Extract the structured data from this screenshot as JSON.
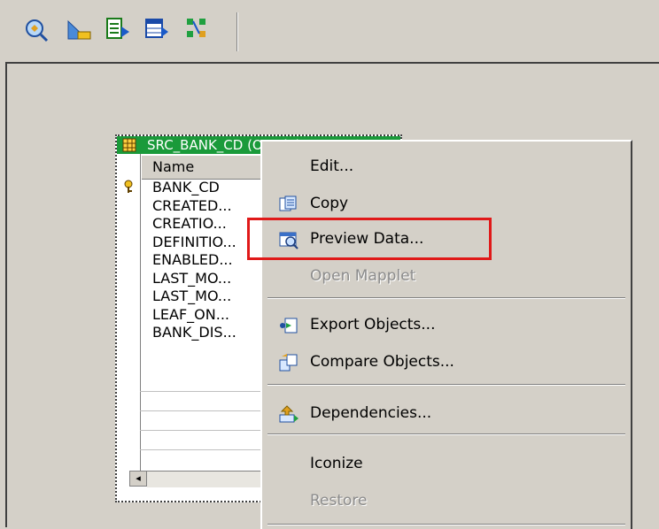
{
  "toolbar": {
    "buttons": [
      {
        "icon": "source-analyzer-icon"
      },
      {
        "icon": "target-designer-icon"
      },
      {
        "icon": "transformation-developer-icon"
      },
      {
        "icon": "mapplet-designer-icon"
      },
      {
        "icon": "mapping-designer-icon"
      }
    ]
  },
  "source_widget": {
    "title": "SRC_BANK_CD (Oracle)",
    "column_header": "Name",
    "rows": [
      "BANK_CD",
      "CREATED...",
      "CREATIO...",
      "DEFINITIO...",
      "ENABLED...",
      "LAST_MO...",
      "LAST_MO...",
      "LEAF_ON...",
      "BANK_DIS..."
    ],
    "scroll_left_arrow": "◂"
  },
  "context_menu": {
    "items": [
      {
        "label": "Edit...",
        "enabled": true
      },
      {
        "label": "Copy",
        "enabled": true,
        "icon": "copy-icon"
      },
      {
        "label": "Preview Data...",
        "enabled": true,
        "icon": "preview-data-icon"
      },
      {
        "label": "Open Mapplet",
        "enabled": false
      },
      {
        "label": "Export Objects...",
        "enabled": true,
        "icon": "export-icon"
      },
      {
        "label": "Compare Objects...",
        "enabled": true,
        "icon": "compare-icon"
      },
      {
        "label": "Dependencies...",
        "enabled": true,
        "icon": "dependencies-icon"
      },
      {
        "label": "Iconize",
        "enabled": true
      },
      {
        "label": "Restore",
        "enabled": false
      }
    ]
  },
  "colors": {
    "title_bar": "#1a9a3a",
    "highlight": "#e01919",
    "menu_bg": "#d4d0c8"
  }
}
